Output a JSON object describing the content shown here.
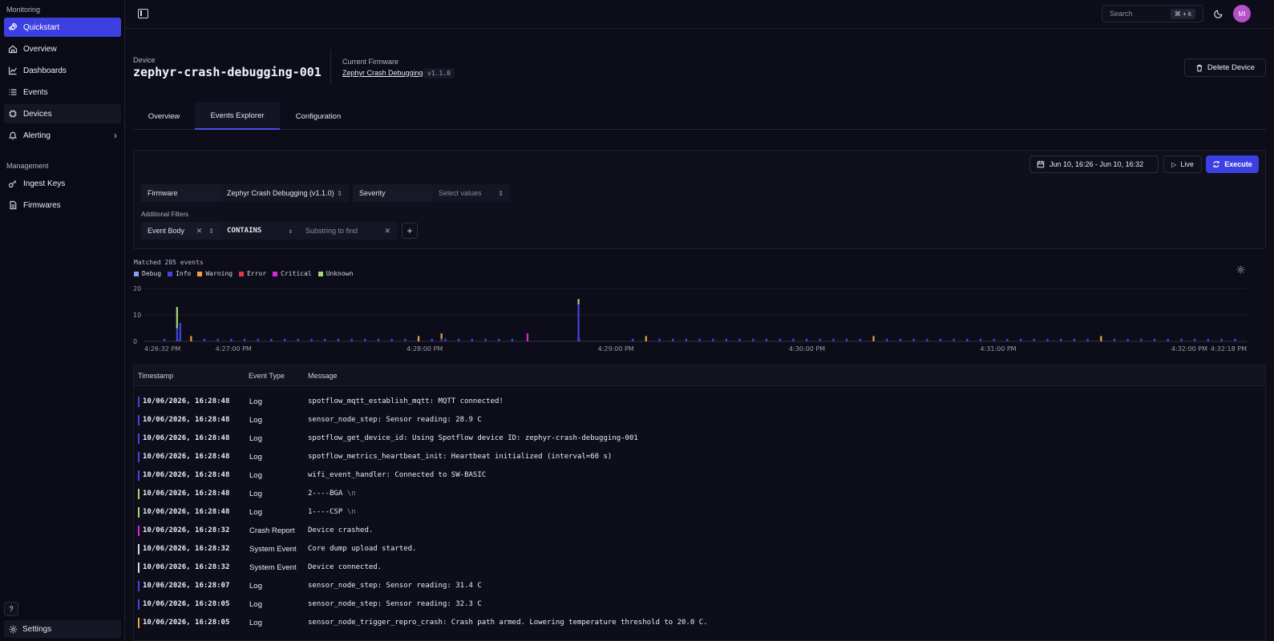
{
  "sidebar": {
    "monitoring_title": "Monitoring",
    "management_title": "Management",
    "items": [
      {
        "label": "Quickstart",
        "icon": "rocket-icon"
      },
      {
        "label": "Overview",
        "icon": "home-icon"
      },
      {
        "label": "Dashboards",
        "icon": "chart-line-icon"
      },
      {
        "label": "Events",
        "icon": "list-icon"
      },
      {
        "label": "Devices",
        "icon": "chip-icon"
      },
      {
        "label": "Alerting",
        "icon": "bell-icon"
      }
    ],
    "management_items": [
      {
        "label": "Ingest Keys",
        "icon": "key-icon"
      },
      {
        "label": "Firmwares",
        "icon": "file-icon"
      }
    ],
    "help_label": "?",
    "settings_label": "Settings"
  },
  "topbar": {
    "search_placeholder": "Search",
    "search_shortcut": "⌘ + k",
    "avatar_initials": "MI"
  },
  "device": {
    "label": "Device",
    "name": "zephyr-crash-debugging-001",
    "firmware_label": "Current Firmware",
    "firmware_name": "Zephyr Crash Debugging",
    "firmware_version": "v1.1.0",
    "delete_label": "Delete Device"
  },
  "tabs": [
    {
      "label": "Overview"
    },
    {
      "label": "Events Explorer"
    },
    {
      "label": "Configuration"
    }
  ],
  "filters": {
    "date_range": "Jun 10, 16:26 - Jun 10, 16:32",
    "live_label": "Live",
    "execute_label": "Execute",
    "firmware_label": "Firmware",
    "firmware_value": "Zephyr Crash Debugging (v1.1.0)",
    "severity_label": "Severity",
    "severity_placeholder": "Select values",
    "additional_label": "Additional Filters",
    "field_value": "Event Body",
    "operator_value": "CONTAINS",
    "substring_placeholder": "Substring to find",
    "add_label": "+"
  },
  "colors": {
    "debug": "#8b9cf0",
    "info": "#4046e0",
    "warning": "#f0a040",
    "error": "#e8364a",
    "critical": "#d82ad8",
    "unknown": "#a6d67c",
    "accent": "#3d40e0"
  },
  "chart_data": {
    "type": "bar",
    "title": "Matched 205 events",
    "legend": [
      "Debug",
      "Info",
      "Warning",
      "Error",
      "Critical",
      "Unknown"
    ],
    "ylim": [
      0,
      20
    ],
    "y_ticks": [
      "20",
      "10",
      "0"
    ],
    "x_ticks": [
      "4:26:32 PM",
      "4:27:00 PM",
      "4:28:00 PM",
      "4:29:00 PM",
      "4:30:00 PM",
      "4:31:00 PM",
      "4:32:00 PM",
      "4:32:18 PM"
    ],
    "x_range": [
      "4:26:32 PM",
      "4:32:18 PM"
    ],
    "notable_bars": [
      {
        "time": "4:26:42 PM",
        "info": 5,
        "unknown": 8
      },
      {
        "time": "4:26:43 PM",
        "info": 7
      },
      {
        "time": "4:28:32 PM",
        "critical": 3
      },
      {
        "time": "4:28:48 PM",
        "info": 14,
        "unknown": 2
      },
      {
        "time": "4:28:05 PM",
        "info": 1,
        "warning": 2
      }
    ],
    "baseline_info_per_bucket": 1
  },
  "table": {
    "headers": [
      "Timestamp",
      "Event Type",
      "Message"
    ],
    "rows": [
      {
        "ts": "10/06/2026, 16:28:48",
        "type": "Log",
        "msg": "spotflow_mqtt_establish_mqtt: MQTT connected!",
        "esc": "",
        "sev": "info"
      },
      {
        "ts": "10/06/2026, 16:28:48",
        "type": "Log",
        "msg": "sensor_node_step: Sensor reading: 28.9 C",
        "esc": "",
        "sev": "info"
      },
      {
        "ts": "10/06/2026, 16:28:48",
        "type": "Log",
        "msg": "spotflow_get_device_id: Using Spotflow device ID: zephyr-crash-debugging-001",
        "esc": "",
        "sev": "info"
      },
      {
        "ts": "10/06/2026, 16:28:48",
        "type": "Log",
        "msg": "spotflow_metrics_heartbeat_init: Heartbeat initialized (interval=60 s)",
        "esc": "",
        "sev": "info"
      },
      {
        "ts": "10/06/2026, 16:28:48",
        "type": "Log",
        "msg": "wifi_event_handler: Connected to SW-BASIC",
        "esc": "",
        "sev": "info"
      },
      {
        "ts": "10/06/2026, 16:28:48",
        "type": "Log",
        "msg": "2----BGA",
        "esc": "\\n",
        "sev": "unknown"
      },
      {
        "ts": "10/06/2026, 16:28:48",
        "type": "Log",
        "msg": "1----CSP",
        "esc": "\\n",
        "sev": "unknown"
      },
      {
        "ts": "10/06/2026, 16:28:32",
        "type": "Crash Report",
        "msg": "Device crashed.",
        "esc": "",
        "sev": "critical"
      },
      {
        "ts": "10/06/2026, 16:28:32",
        "type": "System Event",
        "msg": "Core dump upload started.",
        "esc": "",
        "sev": "plain"
      },
      {
        "ts": "10/06/2026, 16:28:32",
        "type": "System Event",
        "msg": "Device connected.",
        "esc": "",
        "sev": "plain"
      },
      {
        "ts": "10/06/2026, 16:28:07",
        "type": "Log",
        "msg": "sensor_node_step: Sensor reading: 31.4 C",
        "esc": "",
        "sev": "info"
      },
      {
        "ts": "10/06/2026, 16:28:05",
        "type": "Log",
        "msg": "sensor_node_step: Sensor reading: 32.3 C",
        "esc": "",
        "sev": "info"
      },
      {
        "ts": "10/06/2026, 16:28:05",
        "type": "Log",
        "msg": "sensor_node_trigger_repro_crash: Crash path armed. Lowering temperature threshold to 20.0 C.",
        "esc": "",
        "sev": "warning"
      }
    ]
  }
}
